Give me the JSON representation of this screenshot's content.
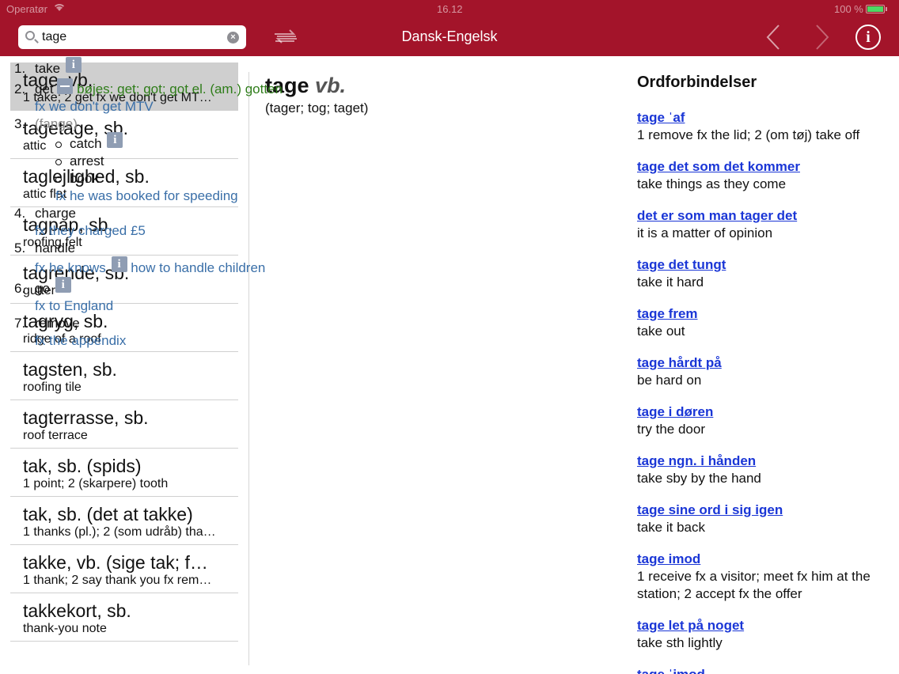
{
  "status_bar": {
    "carrier": "Operatør",
    "time": "16.12",
    "battery": "100 %"
  },
  "nav": {
    "search_value": "tage",
    "title": "Dansk-Engelsk",
    "swap_icon": "swap-arrows-icon",
    "back_icon": "chevron-left-icon",
    "forward_icon": "chevron-right-icon",
    "info_icon": "info-icon"
  },
  "colors": {
    "brand": "#a3142a",
    "link": "#1a36d6",
    "example": "#3a6fa8",
    "inflection": "#2f7d1a"
  },
  "wordlist": [
    {
      "headword": "tage, vb.",
      "translation": "1 take; 2 get fx we don't get MT…"
    },
    {
      "headword": "tagetage, sb.",
      "translation": "attic"
    },
    {
      "headword": "taglejlighed, sb.",
      "translation": "attic flat"
    },
    {
      "headword": "tagpap, sb.",
      "translation": "roofing felt"
    },
    {
      "headword": "tagrende, sb.",
      "translation": "gutter"
    },
    {
      "headword": "tagryg, sb.",
      "translation": "ridge of a roof"
    },
    {
      "headword": "tagsten, sb.",
      "translation": "roofing tile"
    },
    {
      "headword": "tagterrasse, sb.",
      "translation": "roof terrace"
    },
    {
      "headword": "tak, sb. (spids)",
      "translation": "1 point; 2 (skarpere) tooth"
    },
    {
      "headword": "tak, sb. (det at takke)",
      "translation": "1 thanks (pl.); 2 (som udråb) tha…"
    },
    {
      "headword": "takke, vb. (sige tak; f…",
      "translation": "1 thank; 2 say thank you fx rem…"
    },
    {
      "headword": "takkekort, sb.",
      "translation": "thank-you note"
    }
  ],
  "entry": {
    "headword": "tage",
    "pos": "vb.",
    "forms": "(tager; tog; taget)",
    "senses": {
      "s1": {
        "num": "1.",
        "text": "take"
      },
      "s2": {
        "num": "2.",
        "text": "get",
        "inflection": "bøjes: get; got; got el. (am.) gotten",
        "ex_fx": "fx",
        "ex": "we don't get MTV"
      },
      "s3": {
        "num": "3.",
        "text": "(fange)",
        "subs": [
          "catch",
          "arrest",
          "book"
        ],
        "ex_fx": "fx",
        "ex": "he was booked for speeding"
      },
      "s4": {
        "num": "4.",
        "text": "charge",
        "ex_fx": "fx",
        "ex": "they charged £5"
      },
      "s5": {
        "num": "5.",
        "text": "handle",
        "ex_fx": "fx",
        "ex_a": "he knows",
        "ex_b": "how to handle children"
      },
      "s6": {
        "num": "6.",
        "text": "go",
        "ex_fx": "fx",
        "ex": "to England"
      },
      "s7": {
        "num": "7.",
        "text": "remove",
        "ex_fx": "fx",
        "ex": "the appendix"
      }
    }
  },
  "phrases": {
    "title": "Ordforbindelser",
    "items": [
      {
        "phrase": "tage ˈaf",
        "translation": "1 remove fx the lid; 2 (om tøj) take off"
      },
      {
        "phrase": "tage det som det kommer",
        "translation": "take things as they come"
      },
      {
        "phrase": "det er som man tager det",
        "translation": "it is a matter of opinion"
      },
      {
        "phrase": "tage det tungt",
        "translation": "take it hard"
      },
      {
        "phrase": "tage frem",
        "translation": "take out"
      },
      {
        "phrase": "tage hårdt på",
        "translation": "be hard on"
      },
      {
        "phrase": "tage i døren",
        "translation": "try the door"
      },
      {
        "phrase": "tage ngn. i hånden",
        "translation": "take sby by the hand"
      },
      {
        "phrase": "tage sine ord i sig igen",
        "translation": "take it back"
      },
      {
        "phrase": "tage imod",
        "translation": "1 receive fx a visitor; meet fx him at the station; 2 accept fx the offer"
      },
      {
        "phrase": "tage let på noget",
        "translation": "take sth lightly"
      },
      {
        "phrase": "tage ˈimod",
        "translation": ""
      }
    ]
  }
}
